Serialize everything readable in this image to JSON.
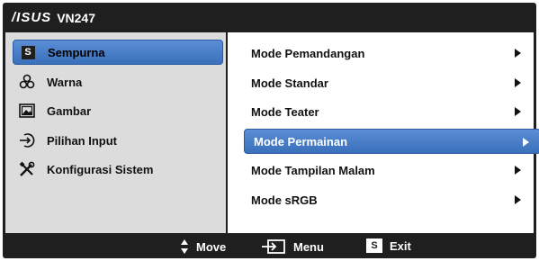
{
  "title": {
    "logo": "/ISUS",
    "model": "VN247"
  },
  "colors": {
    "accent": "#3a6fba",
    "frame": "#1f1f1f",
    "left_bg": "#dcdcdc"
  },
  "main_menu": [
    {
      "label": "Sempurna",
      "icon": "splendid-s-icon",
      "selected": true
    },
    {
      "label": "Warna",
      "icon": "color-circles-icon",
      "selected": false
    },
    {
      "label": "Gambar",
      "icon": "image-icon",
      "selected": false
    },
    {
      "label": "Pilihan Input",
      "icon": "input-arrow-icon",
      "selected": false
    },
    {
      "label": "Konfigurasi Sistem",
      "icon": "tools-icon",
      "selected": false
    }
  ],
  "sub_menu": [
    {
      "label": "Mode Pemandangan",
      "selected": false
    },
    {
      "label": "Mode Standar",
      "selected": false
    },
    {
      "label": "Mode Teater",
      "selected": false
    },
    {
      "label": "Mode Permainan",
      "selected": true
    },
    {
      "label": "Mode Tampilan Malam",
      "selected": false
    },
    {
      "label": "Mode sRGB",
      "selected": false
    }
  ],
  "footer": {
    "move_label": "Move",
    "menu_label": "Menu",
    "exit_label": "Exit",
    "exit_badge": "S"
  },
  "badge_letter": "S"
}
